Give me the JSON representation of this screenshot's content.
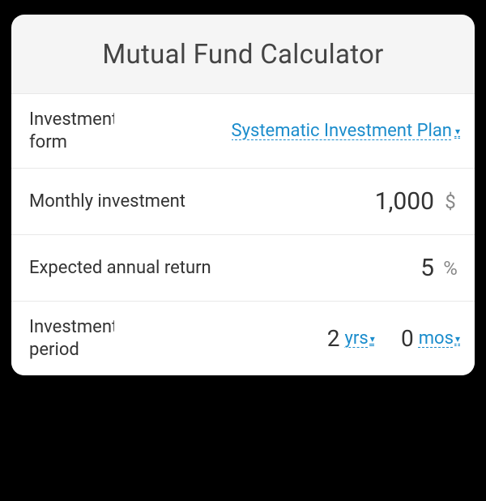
{
  "title": "Mutual Fund Calculator",
  "rows": {
    "investment_form": {
      "label": "Investment form",
      "value": "Systematic Investment Plan"
    },
    "monthly_investment": {
      "label": "Monthly investment",
      "value": "1,000",
      "unit": "$"
    },
    "expected_return": {
      "label": "Expected annual return",
      "value": "5",
      "unit": "%"
    },
    "investment_period": {
      "label": "Investment period",
      "years_value": "2",
      "years_unit": "yrs",
      "months_value": "0",
      "months_unit": "mos"
    }
  }
}
